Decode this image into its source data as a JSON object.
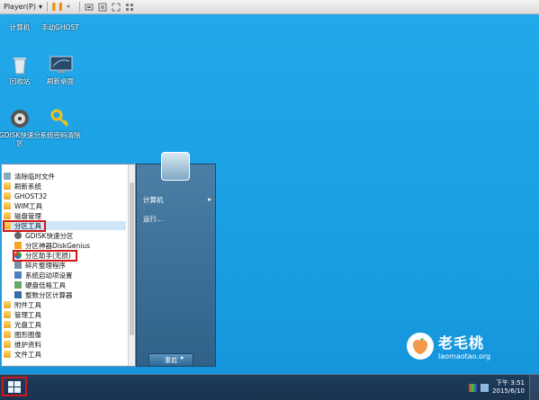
{
  "player_bar": {
    "menu_label": "Player(P)",
    "icons": [
      "pause-icon",
      "send-keys-icon",
      "fit-window-icon",
      "fullscreen-icon",
      "unity-icon"
    ]
  },
  "desktop": {
    "icons": [
      {
        "label": "计算机"
      },
      {
        "label": "手动GHOST"
      },
      {
        "label": "回收站"
      },
      {
        "label": "刷新桌面"
      },
      {
        "label": "GDISK快速分区"
      },
      {
        "label": "系统密码清除"
      }
    ]
  },
  "start_menu": {
    "programs": [
      {
        "label": "清除临时文件",
        "icon": "broom-icon"
      },
      {
        "label": "刷新系统",
        "icon": "folder-icon"
      },
      {
        "label": "GHOST32",
        "icon": "folder-icon"
      },
      {
        "label": "WIM工具",
        "icon": "folder-icon"
      },
      {
        "label": "磁盘管理",
        "icon": "folder-icon"
      },
      {
        "label": "分区工具",
        "icon": "folder-icon"
      },
      {
        "label": "GDISK快速分区",
        "icon": "gdisk-icon"
      },
      {
        "label": "分区神器DiskGenius",
        "icon": "diskgenius-icon"
      },
      {
        "label": "分区助手(无损)",
        "icon": "partition-assistant-icon"
      },
      {
        "label": "碎片整理程序",
        "icon": "defrag-icon"
      },
      {
        "label": "系统启动项设置",
        "icon": "boot-icon"
      },
      {
        "label": "硬盘低格工具",
        "icon": "hdd-icon"
      },
      {
        "label": "整数分区计算器",
        "icon": "calculator-icon"
      },
      {
        "label": "附件工具",
        "icon": "folder-icon"
      },
      {
        "label": "管理工具",
        "icon": "folder-icon"
      },
      {
        "label": "光盘工具",
        "icon": "folder-icon"
      },
      {
        "label": "图形图像",
        "icon": "folder-icon"
      },
      {
        "label": "维护资料",
        "icon": "folder-icon"
      },
      {
        "label": "文件工具",
        "icon": "folder-icon"
      }
    ],
    "right": {
      "computer": "计算机",
      "run": "运行..."
    },
    "shutdown_label": "重启"
  },
  "watermark": {
    "brand": "老毛桃",
    "url": "laomaotao.org"
  },
  "taskbar": {
    "time": "下午 3:51",
    "date": "2015/6/10"
  },
  "colors": {
    "desktop": "#1a9fe3",
    "taskbar": "#1e3c5c",
    "highlight": "#d01818"
  }
}
